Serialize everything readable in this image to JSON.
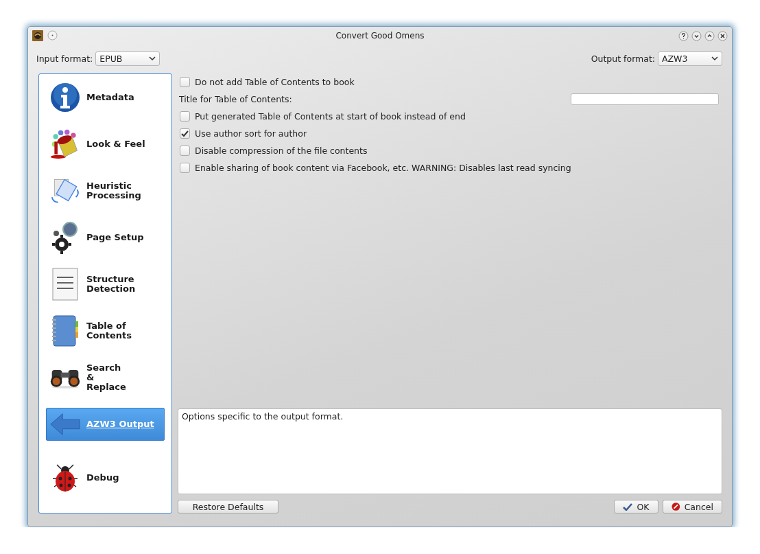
{
  "window": {
    "title": "Convert Good Omens"
  },
  "input_format": {
    "label": "Input format:",
    "value": "EPUB"
  },
  "output_format": {
    "label": "Output format:",
    "value": "AZW3"
  },
  "sidebar": {
    "items": [
      {
        "label": "Metadata",
        "selected": false
      },
      {
        "label": "Look & Feel",
        "selected": false
      },
      {
        "label": "Heuristic\nProcessing",
        "selected": false
      },
      {
        "label": "Page Setup",
        "selected": false
      },
      {
        "label": "Structure\nDetection",
        "selected": false
      },
      {
        "label": "Table of\nContents",
        "selected": false
      },
      {
        "label": "Search\n&\nReplace",
        "selected": false
      },
      {
        "label": "AZW3 Output",
        "selected": true
      },
      {
        "label": "Debug",
        "selected": false
      }
    ]
  },
  "options": [
    {
      "kind": "checkbox",
      "label": "Do not add Table of Contents to book",
      "checked": false
    },
    {
      "kind": "field",
      "label": "Title for Table of Contents:"
    },
    {
      "kind": "checkbox",
      "label": "Put generated Table of Contents at start of book instead of end",
      "checked": false
    },
    {
      "kind": "checkbox",
      "label": "Use author sort for author",
      "checked": true
    },
    {
      "kind": "checkbox",
      "label": "Disable compression of the file contents",
      "checked": false
    },
    {
      "kind": "checkbox",
      "label": "Enable sharing of book content via Facebook, etc. WARNING: Disables last read syncing",
      "checked": false
    }
  ],
  "description": "Options specific to the output format.",
  "buttons": {
    "restore": "Restore Defaults",
    "ok": "OK",
    "cancel": "Cancel"
  }
}
